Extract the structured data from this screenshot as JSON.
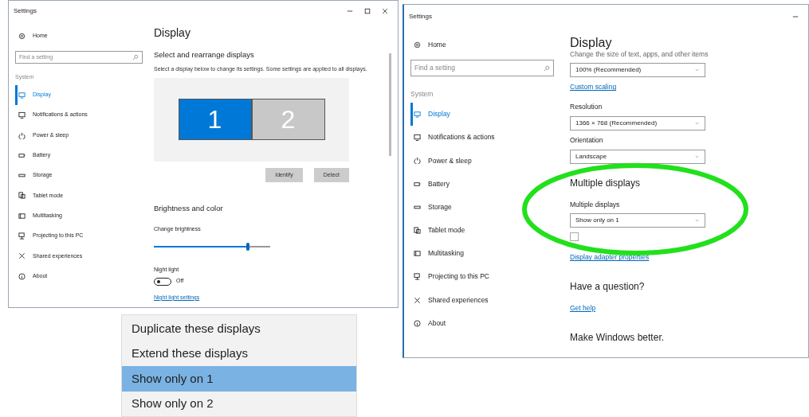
{
  "windows": [
    {
      "title": "Settings",
      "caption": {
        "minimize": true,
        "maximize": true,
        "close": true
      },
      "sidebar": {
        "home": "Home",
        "search": {
          "placeholder": "Find a setting"
        },
        "section": "System",
        "items": [
          {
            "label": "Display",
            "selected": true
          },
          {
            "label": "Notifications & actions",
            "selected": false
          },
          {
            "label": "Power & sleep",
            "selected": false
          },
          {
            "label": "Battery",
            "selected": false
          },
          {
            "label": "Storage",
            "selected": false
          },
          {
            "label": "Tablet mode",
            "selected": false
          },
          {
            "label": "Multitasking",
            "selected": false
          },
          {
            "label": "Projecting to this PC",
            "selected": false
          },
          {
            "label": "Shared experiences",
            "selected": false
          },
          {
            "label": "About",
            "selected": false
          }
        ]
      },
      "page_title": "Display",
      "blocks": [
        {
          "kind": "subheading",
          "text": "Select and rearrange displays"
        },
        {
          "kind": "text",
          "text": "Select a display below to change its settings. Some settings are applied to all displays."
        },
        {
          "kind": "arrangement",
          "monitors": [
            {
              "label": "1",
              "selected": true
            },
            {
              "label": "2",
              "selected": false
            }
          ]
        },
        {
          "kind": "buttons",
          "buttons": [
            "Identify",
            "Detect"
          ]
        },
        {
          "kind": "subheading",
          "text": "Brightness and color"
        },
        {
          "kind": "label",
          "text": "Change brightness"
        },
        {
          "kind": "slider",
          "level": 0.81
        },
        {
          "kind": "label",
          "text": "Night light"
        },
        {
          "kind": "toggle",
          "on": false,
          "text": "Off"
        },
        {
          "kind": "link",
          "text": "Night light settings"
        }
      ]
    },
    {
      "title": "Settings",
      "caption": {
        "minimize": true
      },
      "sidebar": {
        "home": "Home",
        "search": {
          "placeholder": "Find a setting"
        },
        "section": "System",
        "items": [
          {
            "label": "Display",
            "selected": true
          },
          {
            "label": "Notifications & actions",
            "selected": false
          },
          {
            "label": "Power & sleep",
            "selected": false
          },
          {
            "label": "Battery",
            "selected": false
          },
          {
            "label": "Storage",
            "selected": false
          },
          {
            "label": "Tablet mode",
            "selected": false
          },
          {
            "label": "Multitasking",
            "selected": false
          },
          {
            "label": "Projecting to this PC",
            "selected": false
          },
          {
            "label": "Shared experiences",
            "selected": false
          },
          {
            "label": "About",
            "selected": false
          }
        ]
      },
      "page_title": "Display",
      "blocks": [
        {
          "kind": "text",
          "text": "Change the size of text, apps, and other items"
        },
        {
          "kind": "select",
          "value": "100% (Recommended)"
        },
        {
          "kind": "link",
          "text": "Custom scaling"
        },
        {
          "kind": "label",
          "text": "Resolution"
        },
        {
          "kind": "select",
          "value": "1366 × 768 (Recommended)"
        },
        {
          "kind": "label",
          "text": "Orientation"
        },
        {
          "kind": "select",
          "value": "Landscape"
        },
        {
          "kind": "subheading",
          "text": "Multiple displays"
        },
        {
          "kind": "label",
          "text": "Multiple displays"
        },
        {
          "kind": "select",
          "value": "Show only on 1"
        },
        {
          "kind": "checkbox",
          "checked": false,
          "disabled": true
        },
        {
          "kind": "link",
          "text": "Display adapter properties"
        },
        {
          "kind": "subheading",
          "text": "Have a question?"
        },
        {
          "kind": "link",
          "text": "Get help"
        },
        {
          "kind": "subheading",
          "text": "Make Windows better."
        }
      ]
    }
  ],
  "dropdown_list": {
    "options": [
      {
        "label": "Duplicate these displays",
        "selected": false
      },
      {
        "label": "Extend these displays",
        "selected": false
      },
      {
        "label": "Show only on 1",
        "selected": true
      },
      {
        "label": "Show only on 2",
        "selected": false
      }
    ]
  }
}
